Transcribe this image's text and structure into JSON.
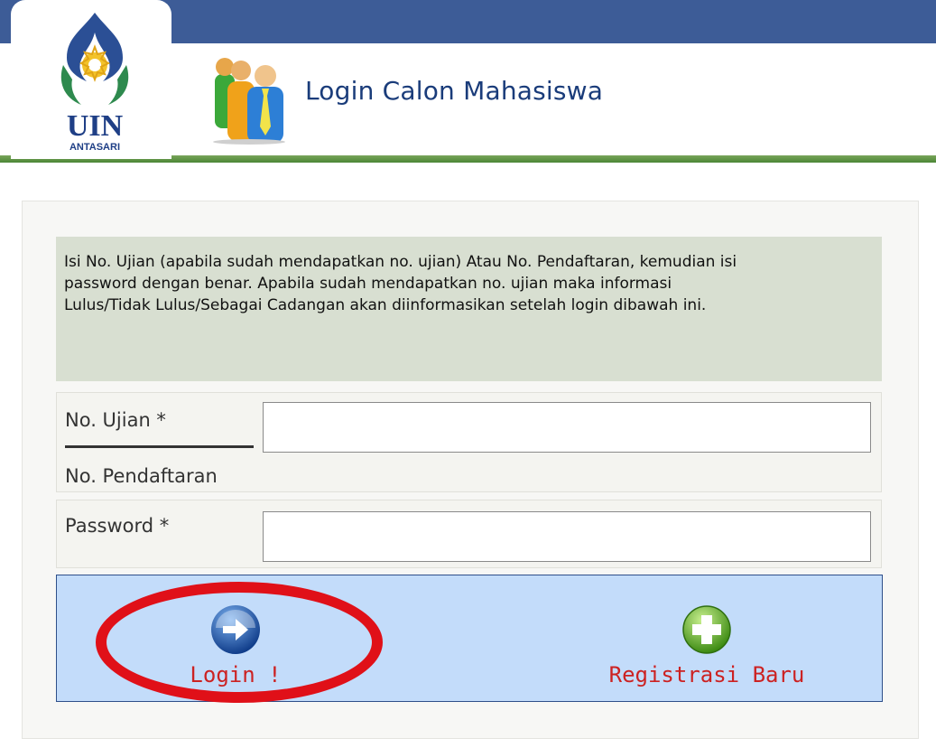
{
  "header": {
    "logo_text": "UIN",
    "logo_subtext": "ANTASARI",
    "title": "Login Calon Mahasiswa"
  },
  "info": {
    "lines": [
      "Isi No. Ujian (apabila sudah mendapatkan no. ujian) Atau No. Pendaftaran, kemudian isi",
      "password dengan benar. Apabila sudah mendapatkan no. ujian maka informasi",
      "Lulus/Tidak Lulus/Sebagai Cadangan akan diinformasikan setelah login dibawah ini."
    ]
  },
  "form": {
    "ujian_label": "No. Ujian *",
    "pendaftaran_label": "No. Pendaftaran",
    "ujian_value": "",
    "password_label": "Password *",
    "password_value": ""
  },
  "actions": {
    "login_label": "Login !",
    "register_label": "Registrasi Baru"
  },
  "colors": {
    "topbar": "#3d5c97",
    "accent_green": "#4b8636",
    "action_bg": "#c3dcfa",
    "action_text": "#cc2222",
    "highlight": "#e01018"
  },
  "icons": {
    "login": "arrow-right-circle-icon",
    "register": "plus-circle-icon",
    "header": "people-icon"
  }
}
